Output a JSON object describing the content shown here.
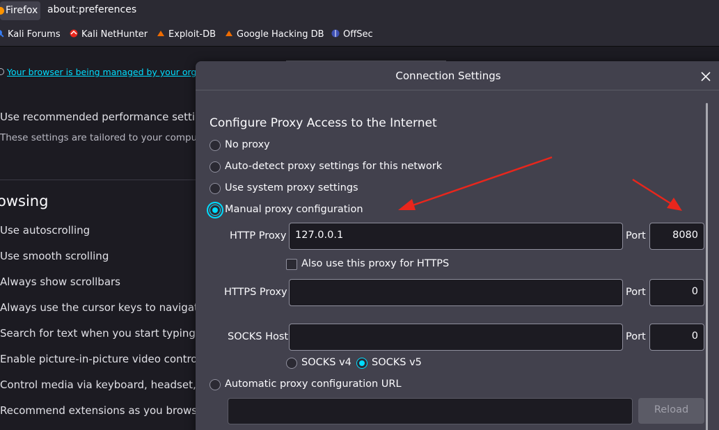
{
  "browser": {
    "identity_label": "Firefox",
    "url": "about:preferences"
  },
  "bookmarks": [
    {
      "label": "Kali Forums",
      "icon": "kali-forums-icon"
    },
    {
      "label": "Kali NetHunter",
      "icon": "kali-nethunter-icon"
    },
    {
      "label": "Exploit-DB",
      "icon": "exploit-db-icon"
    },
    {
      "label": "Google Hacking DB",
      "icon": "google-hacking-db-icon"
    },
    {
      "label": "OffSec",
      "icon": "offsec-icon"
    }
  ],
  "preferences": {
    "managed_notice": "Your browser is being managed by your orga",
    "performance_label": "Use recommended performance setting",
    "performance_sub": "These settings are tailored to your computer",
    "browsing_heading": "owsing",
    "browsing_items": [
      "Use autoscrolling",
      "Use smooth scrolling",
      "Always show scrollbars",
      "Always use the cursor keys to navigate w",
      "Search for text when you start typing",
      "Enable picture-in-picture video controls",
      "Control media via keyboard, headset, or",
      "Recommend extensions as you browse"
    ]
  },
  "dialog": {
    "title": "Connection Settings",
    "heading": "Configure Proxy Access to the Internet",
    "options": {
      "no_proxy": "No proxy",
      "auto_detect": "Auto-detect proxy settings for this network",
      "system": "Use system proxy settings",
      "manual": "Manual proxy configuration",
      "auto_url": "Automatic proxy configuration URL"
    },
    "selected_option": "manual",
    "http_proxy": {
      "label": "HTTP Proxy",
      "value": "127.0.0.1",
      "port_label": "Port",
      "port": "8080"
    },
    "also_https": {
      "label": "Also use this proxy for HTTPS",
      "checked": false
    },
    "https_proxy": {
      "label": "HTTPS Proxy",
      "value": "",
      "port_label": "Port",
      "port": "0"
    },
    "socks_host": {
      "label": "SOCKS Host",
      "value": "",
      "port_label": "Port",
      "port": "0"
    },
    "socks_v4": "SOCKS v4",
    "socks_v5": "SOCKS v5",
    "socks_selected": "v5",
    "pac_url": "",
    "reload_label": "Reload"
  },
  "colors": {
    "accent": "#00ddff",
    "annotation_arrow": "#e8261c",
    "dialog_bg": "#42414d",
    "page_bg": "#1c1b22"
  }
}
